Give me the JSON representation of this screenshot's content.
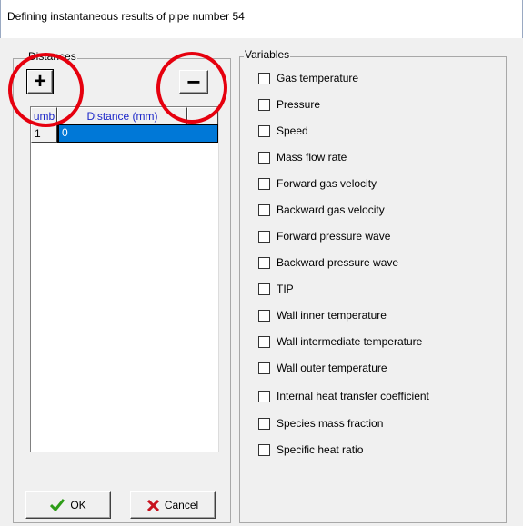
{
  "window": {
    "title": "Defining instantaneous results of pipe number 54"
  },
  "distances": {
    "group_label": "Distances",
    "add_symbol": "+",
    "remove_symbol": "−",
    "columns": [
      "umb",
      "Distance (mm)"
    ],
    "rows": [
      {
        "num": "1",
        "distance": "0"
      }
    ]
  },
  "variables": {
    "group_label": "Variables",
    "items": [
      {
        "label": "Gas temperature",
        "checked": false
      },
      {
        "label": "Pressure",
        "checked": false
      },
      {
        "label": "Speed",
        "checked": false
      },
      {
        "label": "Mass flow rate",
        "checked": false
      },
      {
        "label": "Forward gas velocity",
        "checked": false
      },
      {
        "label": "Backward gas velocity",
        "checked": false
      },
      {
        "label": "Forward pressure wave",
        "checked": false
      },
      {
        "label": "Backward pressure wave",
        "checked": false
      },
      {
        "label": "TIP",
        "checked": false
      },
      {
        "label": "Wall inner temperature",
        "checked": false
      },
      {
        "label": "Wall intermediate temperature",
        "checked": false
      },
      {
        "label": "Wall outer temperature",
        "checked": false
      },
      {
        "label": "Internal heat transfer coefficient",
        "checked": false
      },
      {
        "label": "Species mass fraction",
        "checked": false
      },
      {
        "label": "Specific heat ratio",
        "checked": false
      }
    ]
  },
  "buttons": {
    "ok_label": "OK",
    "cancel_label": "Cancel"
  },
  "colors": {
    "highlight": "#0078d7",
    "annotation": "#e6000e",
    "header_text": "#1c27c9",
    "ok_icon": "#2e9d18",
    "cancel_icon": "#c8121e"
  }
}
